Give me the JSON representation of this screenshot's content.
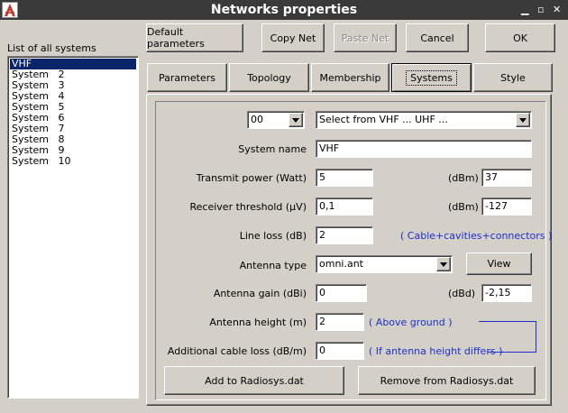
{
  "window": {
    "title": "Networks properties"
  },
  "systems_list": {
    "label": "List of all systems",
    "items": [
      "VHF",
      "System   2",
      "System   3",
      "System   4",
      "System   5",
      "System   6",
      "System   7",
      "System   8",
      "System   9",
      "System   10"
    ]
  },
  "toolbar": {
    "default_params": "Default parameters",
    "copy_net": "Copy Net",
    "paste_net": "Paste Net",
    "cancel": "Cancel",
    "ok": "OK"
  },
  "tabs": [
    "Parameters",
    "Topology",
    "Membership",
    "Systems",
    "Style"
  ],
  "form": {
    "number_select": "00",
    "preset_select": "Select from VHF ... UHF ...",
    "system_name_label": "System name",
    "system_name": "VHF",
    "transmit_power_label": "Transmit power (Watt)",
    "transmit_power": "5",
    "dbm_label": "(dBm)",
    "transmit_dbm": "37",
    "receiver_threshold_label": "Receiver threshold (µV)",
    "receiver_threshold": "0,1",
    "receiver_dbm": "-127",
    "line_loss_label": "Line loss (dB)",
    "line_loss": "2",
    "line_loss_note": "( Cable+cavities+connectors )",
    "antenna_type_label": "Antenna type",
    "antenna_type": "omni.ant",
    "view_button": "View",
    "antenna_gain_label": "Antenna gain (dBi)",
    "antenna_gain": "0",
    "dbd_label": "(dBd)",
    "antenna_gain_dbd": "-2,15",
    "antenna_height_label": "Antenna height (m)",
    "antenna_height": "2",
    "antenna_height_note": "( Above ground )",
    "cable_loss_label": "Additional cable loss (dB/m)",
    "cable_loss": "0",
    "cable_loss_note": "( If antenna height differs )",
    "add_button": "Add to Radiosys.dat",
    "remove_button": "Remove from Radiosys.dat"
  },
  "colors": {
    "titlebar": "#3a3a3a",
    "selection": "#0a246a",
    "note_blue": "#1c2fd0",
    "face": "#d4d0c8"
  }
}
